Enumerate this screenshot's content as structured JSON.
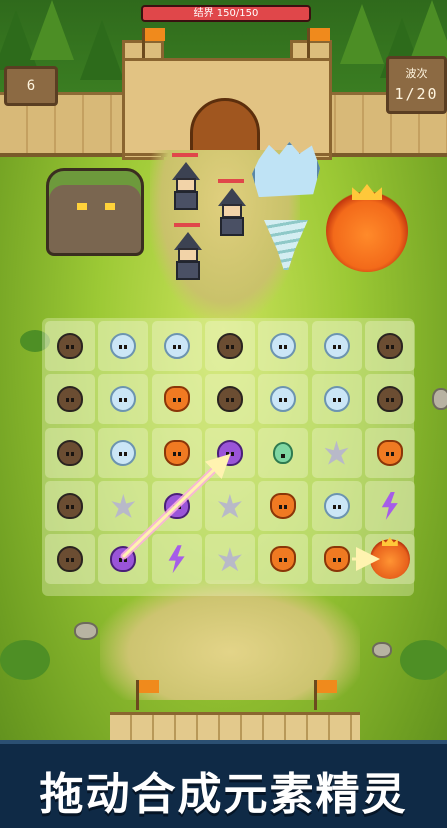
{
  "boss_hp": {
    "label": "结界 150/150",
    "fraction": 1.0,
    "color": "#e0474a"
  },
  "hud": {
    "left_counter": "6",
    "wave_label": "波次",
    "wave_value": "1/20"
  },
  "board": {
    "rows": [
      [
        "earth",
        "water",
        "water",
        "earth",
        "water",
        "water",
        "earth"
      ],
      [
        "earth",
        "water",
        "fire",
        "earth",
        "water",
        "water",
        "earth"
      ],
      [
        "earth",
        "water",
        "fire",
        "dark",
        "green",
        "crystal",
        "fire"
      ],
      [
        "earth",
        "crystal",
        "dark",
        "crystal",
        "fire",
        "water",
        "bolt"
      ],
      [
        "earth",
        "dark",
        "bolt",
        "crystal",
        "fire",
        "fire",
        "fire-king"
      ]
    ]
  },
  "banner": {
    "title": "拖动合成元素精灵"
  },
  "colors": {
    "banner_bg": "#0f2a46",
    "grass": "#9cc935",
    "wall": "#d8b978"
  }
}
